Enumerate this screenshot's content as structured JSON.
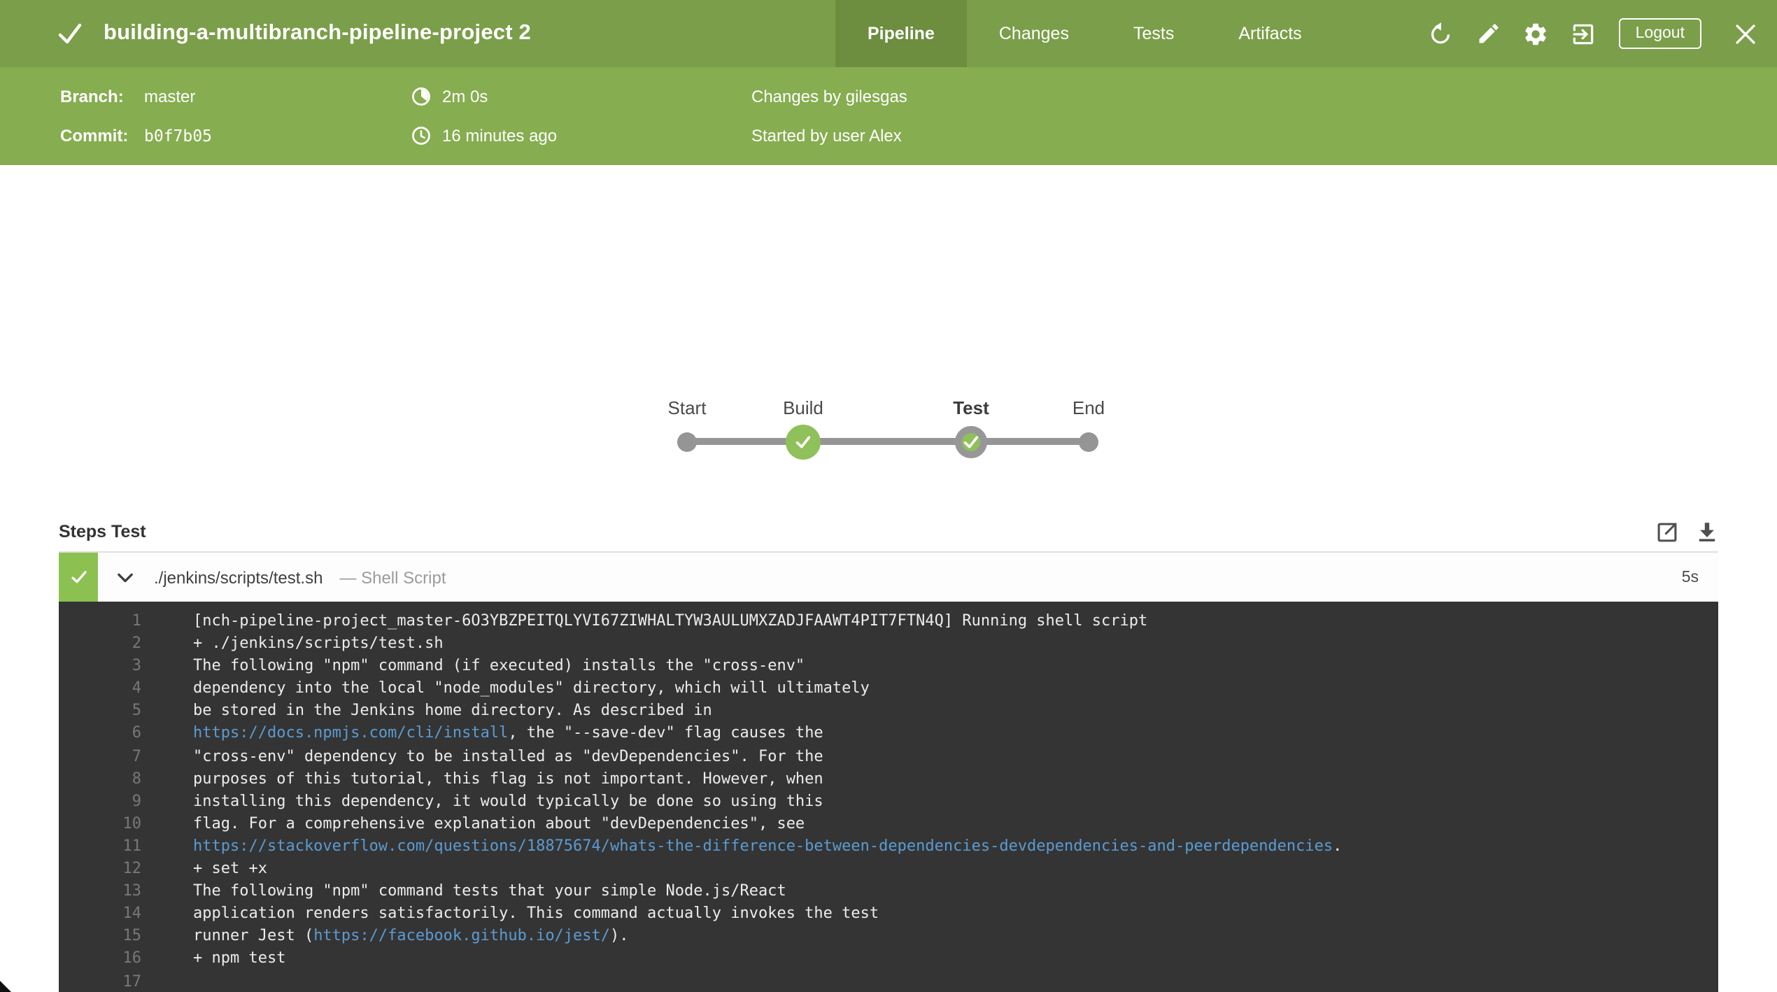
{
  "header": {
    "title": "building-a-multibranch-pipeline-project 2",
    "status": "success",
    "tabs": [
      {
        "label": "Pipeline",
        "active": true
      },
      {
        "label": "Changes",
        "active": false
      },
      {
        "label": "Tests",
        "active": false
      },
      {
        "label": "Artifacts",
        "active": false
      }
    ],
    "actions": {
      "icons": [
        "rerun-icon",
        "edit-icon",
        "settings-icon",
        "exit-to-app-icon",
        "close-icon"
      ],
      "logout_label": "Logout"
    }
  },
  "meta": {
    "branch_label": "Branch:",
    "branch_value": "master",
    "commit_label": "Commit:",
    "commit_value": "b0f7b05",
    "duration": "2m 0s",
    "time_ago": "16 minutes ago",
    "changes_by": "Changes by gilesgas",
    "started_by": "Started by user Alex"
  },
  "pipeline": {
    "stages": [
      {
        "name": "Start",
        "type": "terminal",
        "selected": false
      },
      {
        "name": "Build",
        "type": "success",
        "selected": false
      },
      {
        "name": "Test",
        "type": "success",
        "selected": true
      },
      {
        "name": "End",
        "type": "terminal",
        "selected": false
      }
    ]
  },
  "steps": {
    "heading": "Steps Test",
    "step": {
      "status": "success",
      "name": "./jenkins/scripts/test.sh",
      "kind": "— Shell Script",
      "duration": "5s"
    }
  },
  "console": {
    "lines": [
      {
        "no": "1",
        "segments": [
          {
            "text": "[nch-pipeline-project_master-6O3YBZPEITQLYVI67ZIWHALTYW3AULUMXZADJFAAWT4PIT7FTN4Q] Running shell script"
          }
        ]
      },
      {
        "no": "2",
        "segments": [
          {
            "text": "+ ./jenkins/scripts/test.sh"
          }
        ]
      },
      {
        "no": "3",
        "segments": [
          {
            "text": "The following \"npm\" command (if executed) installs the \"cross-env\""
          }
        ]
      },
      {
        "no": "4",
        "segments": [
          {
            "text": "dependency into the local \"node_modules\" directory, which will ultimately"
          }
        ]
      },
      {
        "no": "5",
        "segments": [
          {
            "text": "be stored in the Jenkins home directory. As described in"
          }
        ]
      },
      {
        "no": "6",
        "segments": [
          {
            "text": "https://docs.npmjs.com/cli/install",
            "link": true
          },
          {
            "text": ", the \"--save-dev\" flag causes the"
          }
        ]
      },
      {
        "no": "7",
        "segments": [
          {
            "text": "\"cross-env\" dependency to be installed as \"devDependencies\". For the"
          }
        ]
      },
      {
        "no": "8",
        "segments": [
          {
            "text": "purposes of this tutorial, this flag is not important. However, when"
          }
        ]
      },
      {
        "no": "9",
        "segments": [
          {
            "text": "installing this dependency, it would typically be done so using this"
          }
        ]
      },
      {
        "no": "10",
        "segments": [
          {
            "text": "flag. For a comprehensive explanation about \"devDependencies\", see"
          }
        ]
      },
      {
        "no": "11",
        "segments": [
          {
            "text": "https://stackoverflow.com/questions/18875674/whats-the-difference-between-dependencies-devdependencies-and-peerdependencies",
            "link": true
          },
          {
            "text": "."
          }
        ]
      },
      {
        "no": "12",
        "segments": [
          {
            "text": "+ set +x"
          }
        ]
      },
      {
        "no": "13",
        "segments": [
          {
            "text": "The following \"npm\" command tests that your simple Node.js/React"
          }
        ]
      },
      {
        "no": "14",
        "segments": [
          {
            "text": "application renders satisfactorily. This command actually invokes the test"
          }
        ]
      },
      {
        "no": "15",
        "segments": [
          {
            "text": "runner Jest ("
          },
          {
            "text": "https://facebook.github.io/jest/",
            "link": true
          },
          {
            "text": ")."
          }
        ]
      },
      {
        "no": "16",
        "segments": [
          {
            "text": "+ npm test"
          }
        ]
      },
      {
        "no": "17",
        "segments": []
      }
    ]
  },
  "colors": {
    "header_green": "#7b9e4a",
    "active_tab_green": "#6d8d3f",
    "subheader_green": "#86ad50",
    "node_green": "#8fc05a",
    "graph_gray": "#959595",
    "console_bg": "#343434",
    "link_blue": "#5b9bd1"
  }
}
